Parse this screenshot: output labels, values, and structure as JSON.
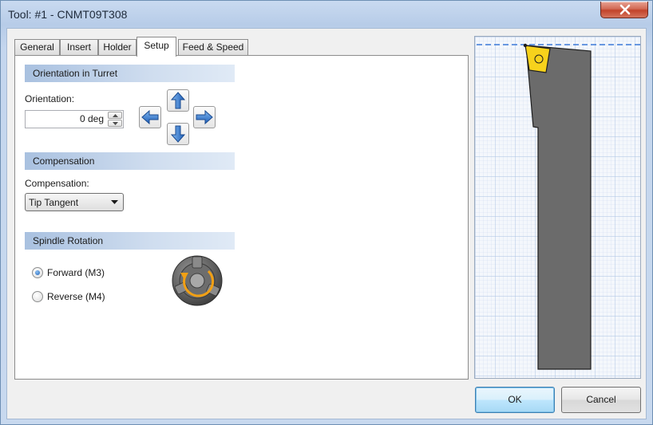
{
  "window": {
    "title": "Tool: #1 - CNMT09T308"
  },
  "tabs": [
    {
      "label": "General",
      "active": false
    },
    {
      "label": "Insert",
      "active": false
    },
    {
      "label": "Holder",
      "active": false
    },
    {
      "label": "Setup",
      "active": true
    },
    {
      "label": "Feed & Speed",
      "active": false
    }
  ],
  "orientation": {
    "section_title": "Orientation in Turret",
    "field_label": "Orientation:",
    "value": "0 deg",
    "arrow_icons": [
      "arrow-up-icon",
      "arrow-left-icon",
      "arrow-right-icon",
      "arrow-down-icon"
    ]
  },
  "compensation": {
    "section_title": "Compensation",
    "field_label": "Compensation:",
    "selected": "Tip Tangent"
  },
  "spindle": {
    "section_title": "Spindle Rotation",
    "options": [
      {
        "label": "Forward (M3)",
        "checked": true
      },
      {
        "label": "Reverse (M4)",
        "checked": false
      }
    ],
    "icon": "spindle-chuck-icon"
  },
  "buttons": {
    "ok": "OK",
    "cancel": "Cancel"
  },
  "colors": {
    "insert": "#f7d21c",
    "holder": "#6b6b6b",
    "grid_line": "#bcd0ea",
    "axis_dash": "#3a78d8",
    "section_header": "#a9c1e0"
  }
}
